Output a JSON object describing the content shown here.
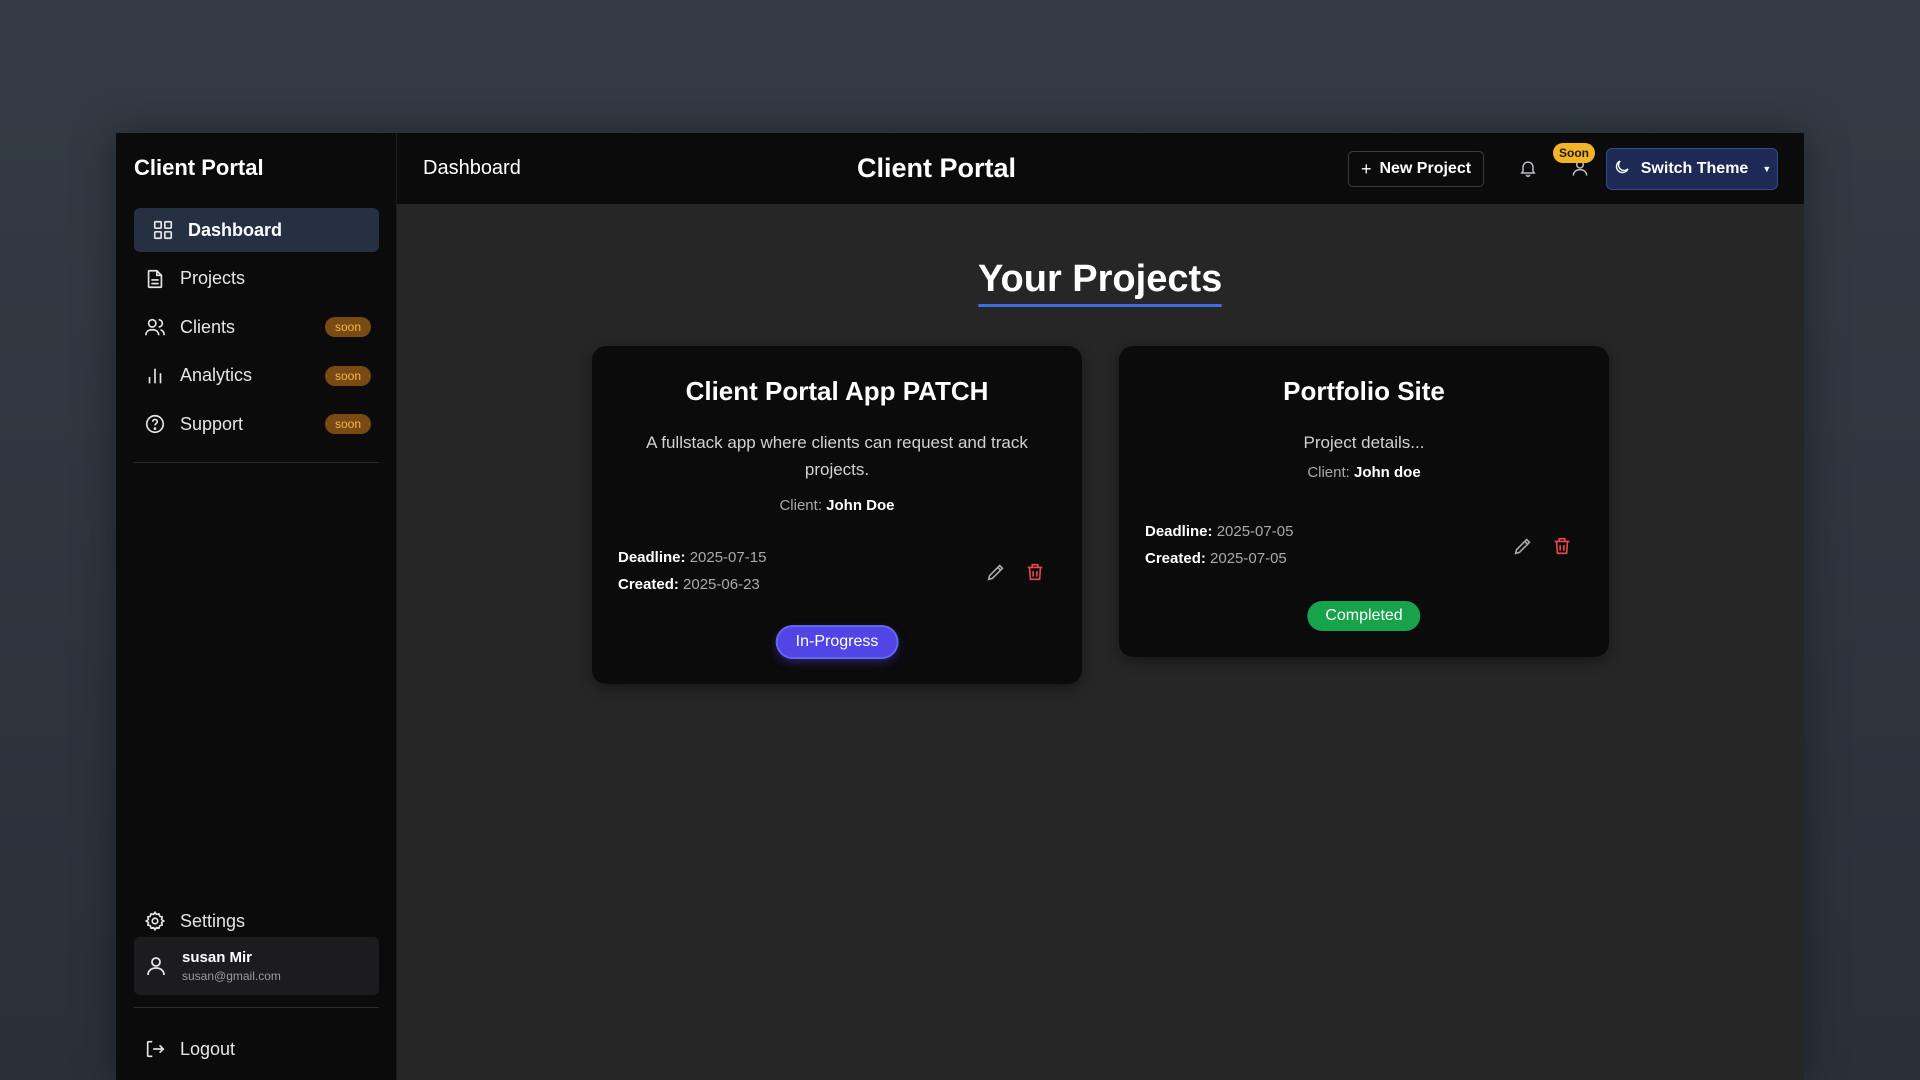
{
  "sidebar": {
    "brand": "Client Portal",
    "items": [
      {
        "label": "Dashboard",
        "icon": "grid-icon",
        "active": true
      },
      {
        "label": "Projects",
        "icon": "document-icon"
      },
      {
        "label": "Clients",
        "icon": "users-icon",
        "badge": "soon"
      },
      {
        "label": "Analytics",
        "icon": "bar-chart-icon",
        "badge": "soon"
      },
      {
        "label": "Support",
        "icon": "help-icon",
        "badge": "soon"
      }
    ],
    "settings_label": "Settings",
    "user": {
      "name": "susan Mir",
      "email": "susan@gmail.com"
    },
    "logout_label": "Logout"
  },
  "topbar": {
    "title": "Dashboard",
    "center_title": "Client Portal",
    "new_project_label": "New Project",
    "soon_badge": "Soon",
    "theme_label": "Switch Theme"
  },
  "main": {
    "heading": "Your Projects",
    "projects": [
      {
        "title": "Client Portal App PATCH",
        "description": "A fullstack app where clients can request and track projects.",
        "client_label": "Client:",
        "client": "John Doe",
        "deadline_label": "Deadline:",
        "deadline": "2025-07-15",
        "created_label": "Created:",
        "created": "2025-06-23",
        "status": "In-Progress"
      },
      {
        "title": "Portfolio Site",
        "description": "Project details...",
        "client_label": "Client:",
        "client": "John doe",
        "deadline_label": "Deadline:",
        "deadline": "2025-07-05",
        "created_label": "Created:",
        "created": "2025-07-05",
        "status": "Completed"
      }
    ]
  },
  "colors": {
    "accent": "#3b6fe0",
    "in_progress": "#4f46e5",
    "completed": "#16a34a",
    "delete": "#e5484d",
    "soon_badge": "#f1b526"
  }
}
